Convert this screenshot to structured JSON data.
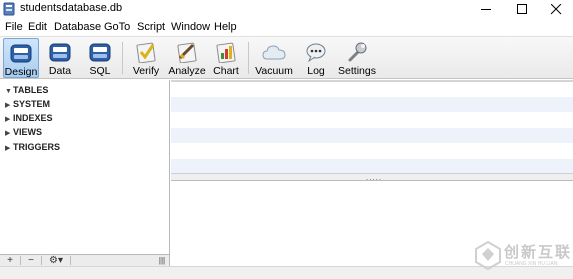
{
  "window": {
    "title": "studentsdatabase.db"
  },
  "menu": [
    "File",
    "Edit",
    "Database",
    "GoTo",
    "Script",
    "Window",
    "Help"
  ],
  "toolbar": {
    "buttons": [
      {
        "label": "Design",
        "icon": "design-db-icon",
        "active": true
      },
      {
        "label": "Data",
        "icon": "data-db-icon"
      },
      {
        "label": "SQL",
        "icon": "sql-db-icon"
      },
      {
        "label": "Verify",
        "icon": "verify-icon"
      },
      {
        "label": "Analyze",
        "icon": "analyze-icon"
      },
      {
        "label": "Chart",
        "icon": "chart-icon"
      },
      {
        "label": "Vacuum",
        "icon": "cloud-icon"
      },
      {
        "label": "Log",
        "icon": "speech-bubble-icon"
      },
      {
        "label": "Settings",
        "icon": "wrench-icon"
      }
    ]
  },
  "tree": [
    "TABLES",
    "SYSTEM",
    "INDEXES",
    "VIEWS",
    "TRIGGERS"
  ],
  "left_footer": {
    "add": "+",
    "remove": "−",
    "gear": "⚙▾",
    "grip": "|||"
  },
  "splitter": {
    "grip": "....."
  },
  "watermark": {
    "cn": "创新互联",
    "en": "CHUANG XIN HU LIAN"
  },
  "colors": {
    "active_button": "#a9cdef",
    "row_alt": "#eef3fb",
    "accent": "#2f6fb8"
  }
}
